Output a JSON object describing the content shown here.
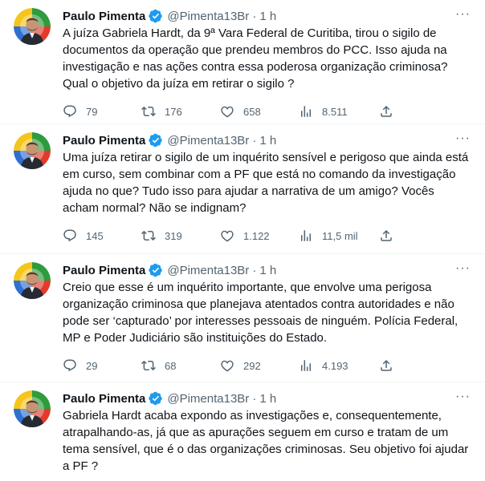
{
  "icons": {
    "more": "more-horizontal-icon",
    "verified": "verified-badge-icon",
    "reply": "reply-icon",
    "retweet": "retweet-icon",
    "like": "heart-icon",
    "views": "views-chart-icon",
    "share": "share-icon"
  },
  "colors": {
    "verified": "#1d9bf0",
    "text": "#0f1419",
    "secondary": "#536471",
    "divider": "#eff3f4"
  },
  "tweets": [
    {
      "name": "Paulo Pimenta",
      "handle": "@Pimenta13Br",
      "dot": "·",
      "time": "1 h",
      "more": "···",
      "text": "A juíza Gabriela Hardt, da 9ª Vara Federal de Curitiba, tirou o sigilo de documentos da operação que prendeu membros do PCC. Isso ajuda na investigação e nas ações contra essa poderosa organização criminosa? Qual o objetivo da juíza em retirar o sigilo ?",
      "replies": "79",
      "retweets": "176",
      "likes": "658",
      "views": "8.511"
    },
    {
      "name": "Paulo Pimenta",
      "handle": "@Pimenta13Br",
      "dot": "·",
      "time": "1 h",
      "more": "···",
      "text": "Uma juíza retirar o sigilo de um inquérito sensível e perigoso que ainda está em curso, sem combinar com a PF que está no comando da investigação ajuda no que? Tudo isso para ajudar a narrativa de um amigo? Vocês acham normal? Não se indignam?",
      "replies": "145",
      "retweets": "319",
      "likes": "1.122",
      "views": "11,5 mil"
    },
    {
      "name": "Paulo Pimenta",
      "handle": "@Pimenta13Br",
      "dot": "·",
      "time": "1 h",
      "more": "···",
      "text": "Creio que esse é um inquérito importante, que envolve uma perigosa organização criminosa que planejava atentados contra autoridades e não pode ser ‘capturado’ por interesses pessoais de ninguém. Polícia Federal, MP e Poder Judiciário são instituições do Estado.",
      "replies": "29",
      "retweets": "68",
      "likes": "292",
      "views": "4.193"
    },
    {
      "name": "Paulo Pimenta",
      "handle": "@Pimenta13Br",
      "dot": "·",
      "time": "1 h",
      "more": "···",
      "text": "Gabriela Hardt acaba expondo as investigações e, consequentemente, atrapalhando-as, já que as apurações seguem em curso e tratam de um tema sensível, que é o das organizações criminosas. Seu objetivo foi ajudar a PF ?"
    }
  ]
}
